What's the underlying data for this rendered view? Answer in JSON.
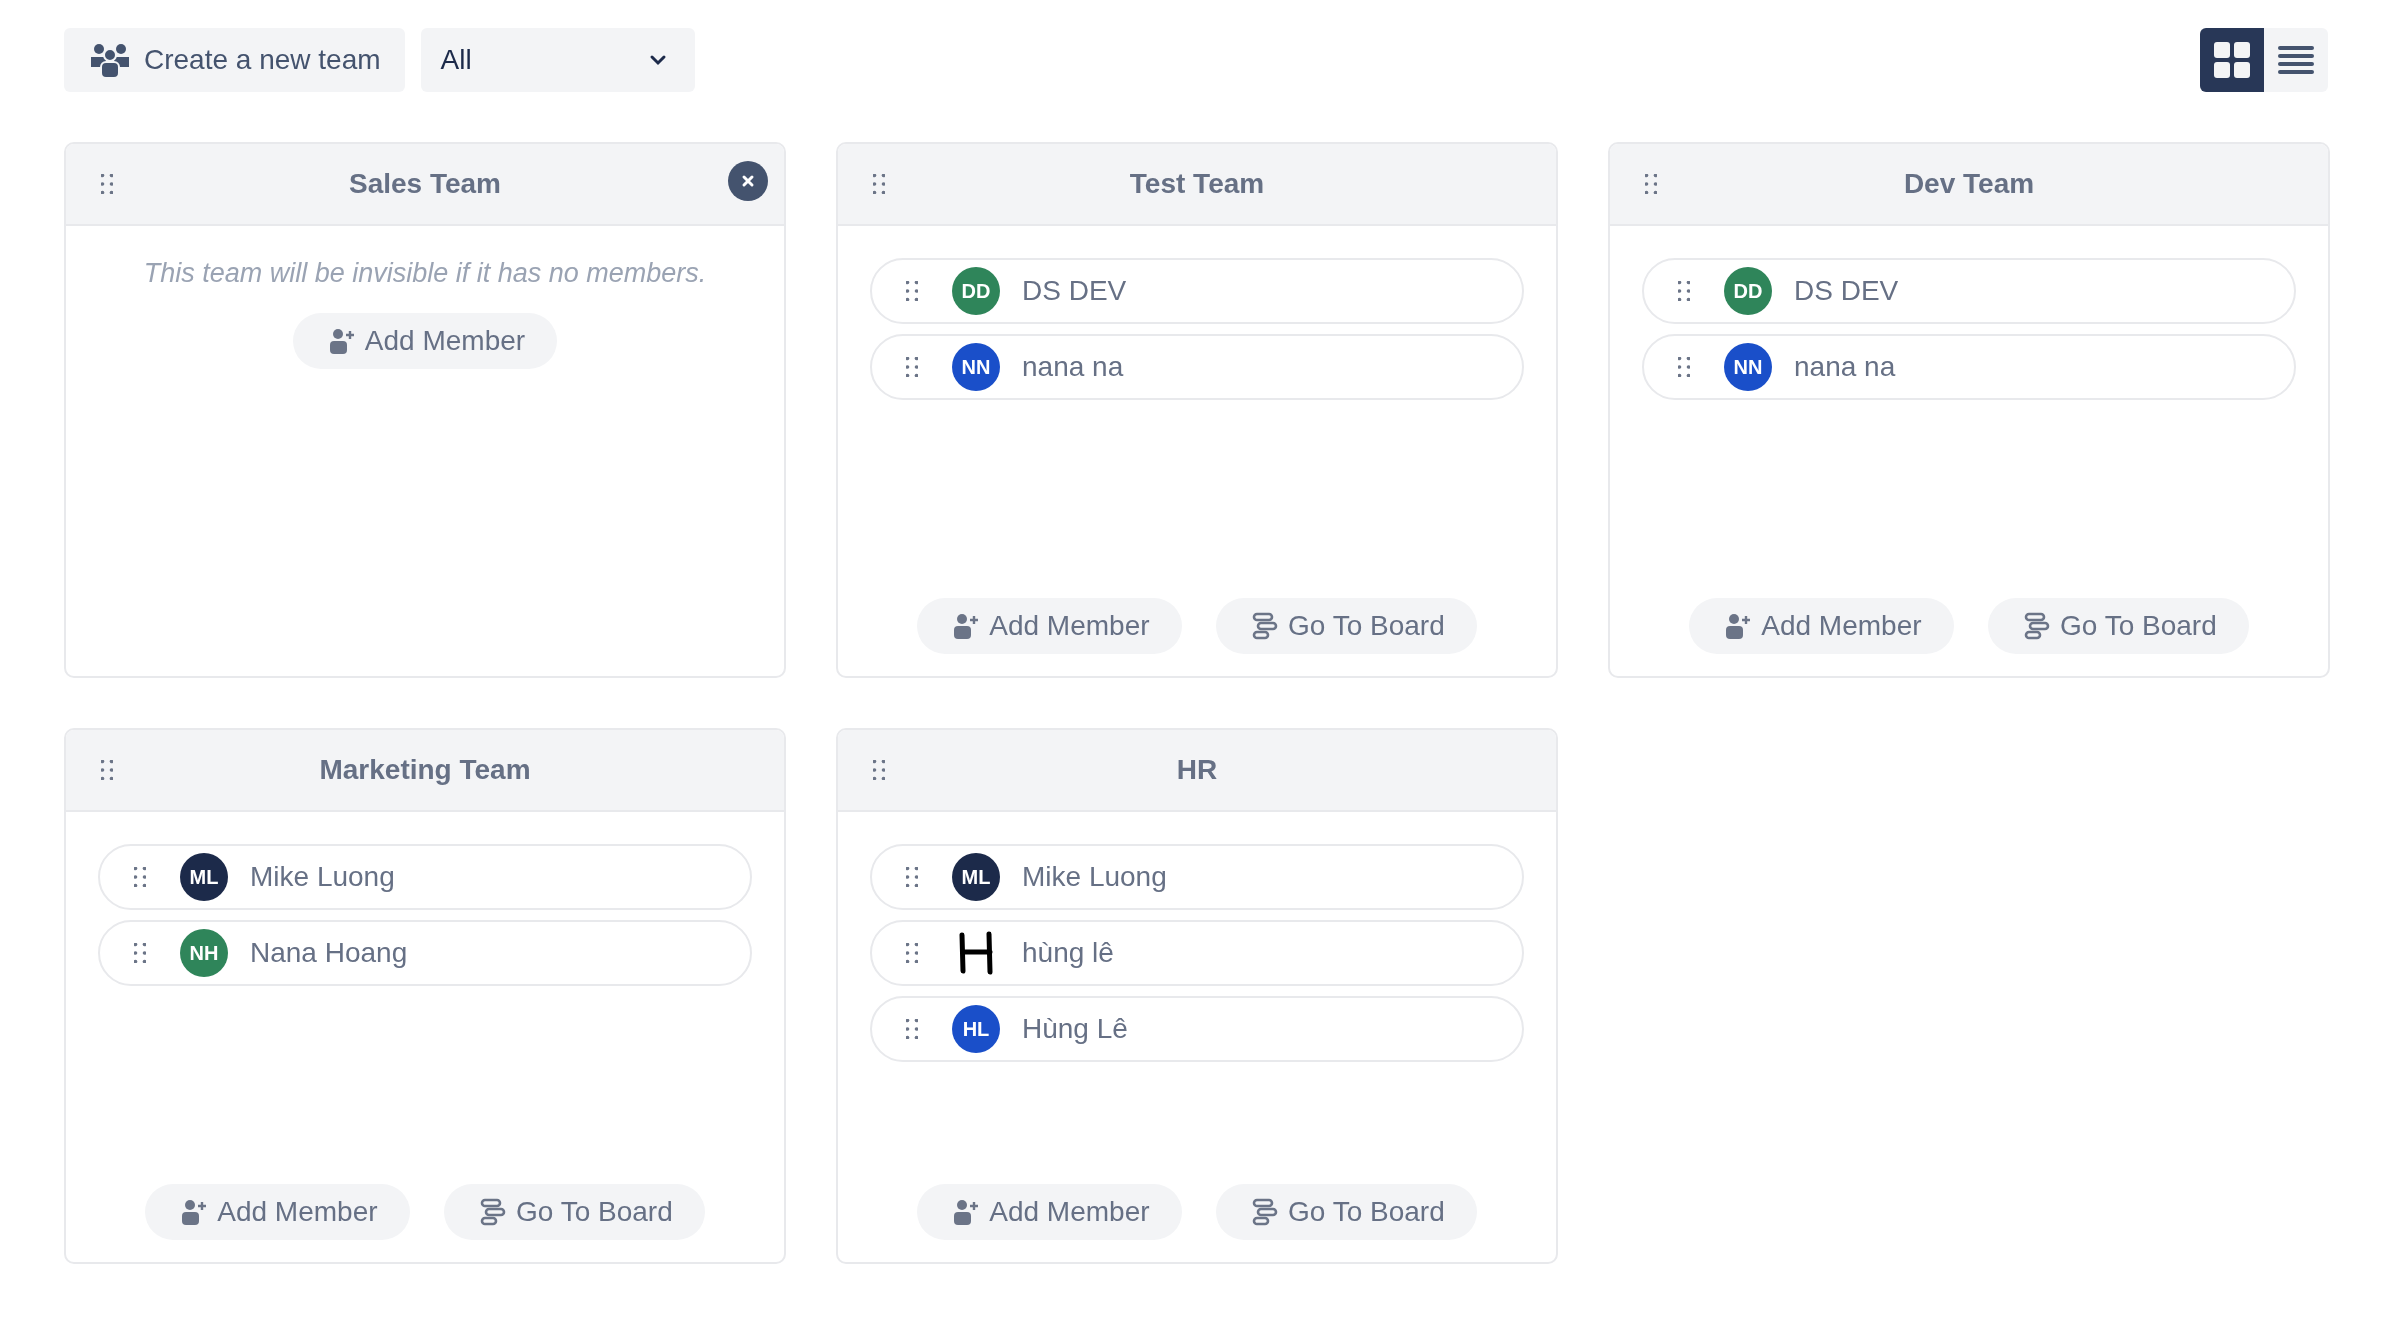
{
  "toolbar": {
    "create_button": "Create a new team",
    "filter": {
      "value": "All"
    },
    "views": [
      {
        "kind": "grid",
        "selected": true
      },
      {
        "kind": "list",
        "selected": false
      }
    ]
  },
  "teams": [
    {
      "name": "Sales Team",
      "removable": true,
      "empty_note": "This team will be invisible if it has no members.",
      "buttons": [
        {
          "kind": "add",
          "label": "Add Member"
        }
      ]
    },
    {
      "name": "Test Team",
      "removable": false,
      "members": [
        {
          "initials": "DD",
          "name": "DS DEV",
          "color": "#2f855a",
          "kind": "initials"
        },
        {
          "initials": "NN",
          "name": "nana na",
          "color": "#1a4fc9",
          "kind": "initials"
        }
      ],
      "buttons": [
        {
          "kind": "add",
          "label": "Add Member"
        },
        {
          "kind": "board",
          "label": "Go To Board"
        }
      ]
    },
    {
      "name": "Dev Team",
      "removable": false,
      "members": [
        {
          "initials": "DD",
          "name": "DS DEV",
          "color": "#2f855a",
          "kind": "initials"
        },
        {
          "initials": "NN",
          "name": "nana na",
          "color": "#1a4fc9",
          "kind": "initials"
        }
      ],
      "buttons": [
        {
          "kind": "add",
          "label": "Add Member"
        },
        {
          "kind": "board",
          "label": "Go To Board"
        }
      ]
    },
    {
      "name": "Marketing Team",
      "removable": false,
      "members": [
        {
          "initials": "ML",
          "name": "Mike Luong",
          "color": "#1c2a4a",
          "kind": "initials"
        },
        {
          "initials": "NH",
          "name": "Nana Hoang",
          "color": "#2f855a",
          "kind": "initials"
        }
      ],
      "buttons": [
        {
          "kind": "add",
          "label": "Add Member"
        },
        {
          "kind": "board",
          "label": "Go To Board"
        }
      ]
    },
    {
      "name": "HR",
      "removable": false,
      "members": [
        {
          "initials": "ML",
          "name": "Mike Luong",
          "color": "#1c2a4a",
          "kind": "initials"
        },
        {
          "name": "hùng lê",
          "kind": "picture"
        },
        {
          "initials": "HL",
          "name": "Hùng Lê",
          "color": "#1a4fc9",
          "kind": "initials"
        }
      ],
      "buttons": [
        {
          "kind": "add",
          "label": "Add Member"
        },
        {
          "kind": "board",
          "label": "Go To Board"
        }
      ]
    }
  ]
}
